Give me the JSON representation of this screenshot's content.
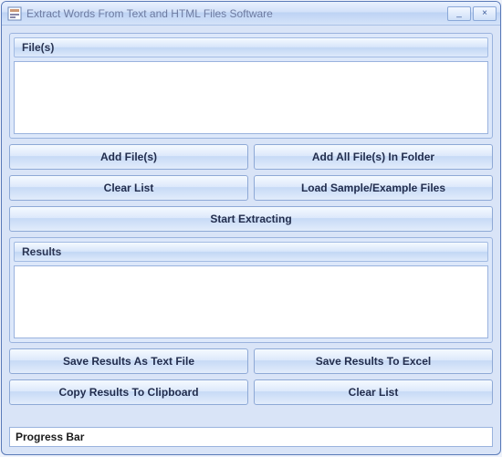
{
  "window": {
    "title": "Extract Words From Text and HTML Files Software"
  },
  "groups": {
    "files_header": "File(s)",
    "results_header": "Results"
  },
  "buttons": {
    "add_files": "Add File(s)",
    "add_all_folder": "Add All File(s) In Folder",
    "clear_list_top": "Clear List",
    "load_sample": "Load Sample/Example Files",
    "start": "Start Extracting",
    "save_text": "Save Results As Text File",
    "save_excel": "Save Results To Excel",
    "copy_clipboard": "Copy Results To Clipboard",
    "clear_list_bottom": "Clear List"
  },
  "status": {
    "progress_label": "Progress Bar"
  },
  "win_controls": {
    "minimize": "_",
    "close": "×"
  }
}
